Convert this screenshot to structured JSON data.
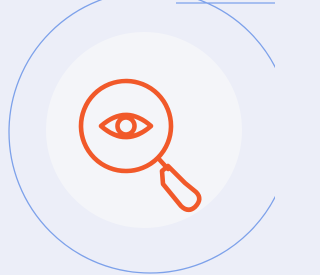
{
  "colors": {
    "background": "#eceef8",
    "outline": "#7da1ea",
    "disc": "#f4f5f9",
    "accent": "#f1592a"
  },
  "icon": {
    "name": "search-eye-icon"
  }
}
